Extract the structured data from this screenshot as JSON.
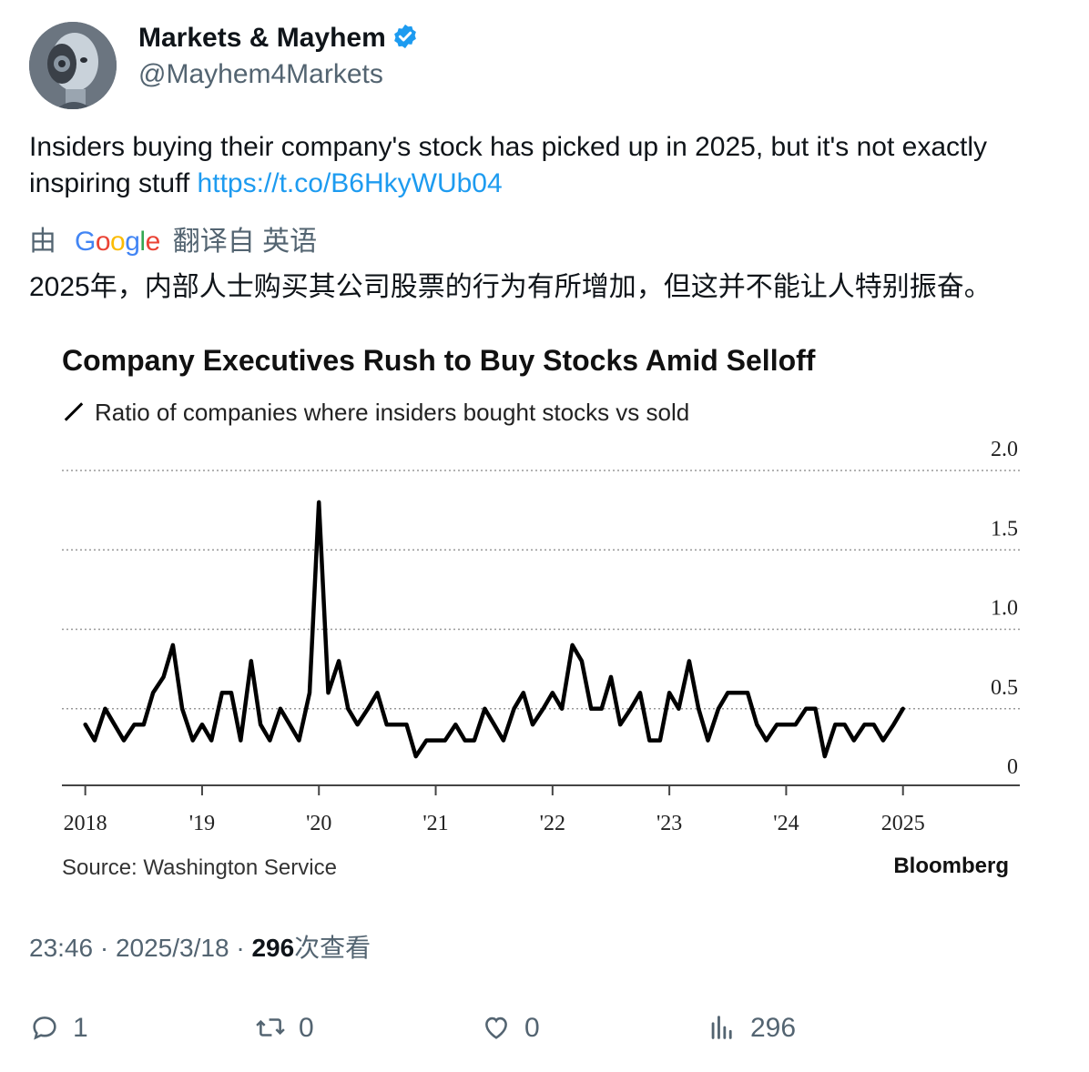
{
  "author": {
    "name": "Markets & Mayhem",
    "handle": "@Mayhem4Markets"
  },
  "tweet": {
    "text": "Insiders buying their company's stock has picked up in 2025, but it's not exactly inspiring stuff ",
    "link": "https://t.co/B6HkyWUb04"
  },
  "translation": {
    "prefix": "由",
    "google_letters": [
      "G",
      "o",
      "o",
      "g",
      "l",
      "e"
    ],
    "google_colors": [
      "#4285F4",
      "#EA4335",
      "#FBBC05",
      "#4285F4",
      "#34A853",
      "#EA4335"
    ],
    "suffix": "翻译自 英语",
    "text": "2025年，内部人士购买其公司股票的行为有所增加，但这并不能让人特别振奋。"
  },
  "chart_data": {
    "type": "line",
    "title": "Company Executives Rush to Buy Stocks Amid Selloff",
    "subtitle": "Ratio of companies where insiders bought stocks vs sold",
    "source": "Source: Washington Service",
    "brand": "Bloomberg",
    "x_tick_labels": [
      "2018",
      "'19",
      "'20",
      "'21",
      "'22",
      "'23",
      "'24",
      "2025"
    ],
    "x_ticks": [
      2018,
      2019,
      2020,
      2021,
      2022,
      2023,
      2024,
      2025
    ],
    "y_tick_labels": [
      "2.0",
      "1.5",
      "1.0",
      "0.5",
      "0"
    ],
    "y_ticks": [
      2.0,
      1.5,
      1.0,
      0.5,
      0
    ],
    "ylim": [
      0,
      2.0
    ],
    "xlim": [
      2017.8,
      2026.0
    ],
    "grid": "horizontal dotted",
    "series": [
      {
        "values": [
          [
            2018.0,
            0.4
          ],
          [
            2018.08,
            0.3
          ],
          [
            2018.17,
            0.5
          ],
          [
            2018.25,
            0.4
          ],
          [
            2018.33,
            0.3
          ],
          [
            2018.42,
            0.4
          ],
          [
            2018.5,
            0.4
          ],
          [
            2018.58,
            0.6
          ],
          [
            2018.67,
            0.7
          ],
          [
            2018.75,
            0.9
          ],
          [
            2018.83,
            0.5
          ],
          [
            2018.92,
            0.3
          ],
          [
            2019.0,
            0.4
          ],
          [
            2019.08,
            0.3
          ],
          [
            2019.17,
            0.6
          ],
          [
            2019.25,
            0.6
          ],
          [
            2019.33,
            0.3
          ],
          [
            2019.42,
            0.8
          ],
          [
            2019.5,
            0.4
          ],
          [
            2019.58,
            0.3
          ],
          [
            2019.67,
            0.5
          ],
          [
            2019.75,
            0.4
          ],
          [
            2019.83,
            0.3
          ],
          [
            2019.92,
            0.6
          ],
          [
            2020.0,
            1.8
          ],
          [
            2020.08,
            0.6
          ],
          [
            2020.17,
            0.8
          ],
          [
            2020.25,
            0.5
          ],
          [
            2020.33,
            0.4
          ],
          [
            2020.42,
            0.5
          ],
          [
            2020.5,
            0.6
          ],
          [
            2020.58,
            0.4
          ],
          [
            2020.67,
            0.4
          ],
          [
            2020.75,
            0.4
          ],
          [
            2020.83,
            0.2
          ],
          [
            2020.92,
            0.3
          ],
          [
            2021.0,
            0.3
          ],
          [
            2021.08,
            0.3
          ],
          [
            2021.17,
            0.4
          ],
          [
            2021.25,
            0.3
          ],
          [
            2021.33,
            0.3
          ],
          [
            2021.42,
            0.5
          ],
          [
            2021.5,
            0.4
          ],
          [
            2021.58,
            0.3
          ],
          [
            2021.67,
            0.5
          ],
          [
            2021.75,
            0.6
          ],
          [
            2021.83,
            0.4
          ],
          [
            2021.92,
            0.5
          ],
          [
            2022.0,
            0.6
          ],
          [
            2022.08,
            0.5
          ],
          [
            2022.17,
            0.9
          ],
          [
            2022.25,
            0.8
          ],
          [
            2022.33,
            0.5
          ],
          [
            2022.42,
            0.5
          ],
          [
            2022.5,
            0.7
          ],
          [
            2022.58,
            0.4
          ],
          [
            2022.67,
            0.5
          ],
          [
            2022.75,
            0.6
          ],
          [
            2022.83,
            0.3
          ],
          [
            2022.92,
            0.3
          ],
          [
            2023.0,
            0.6
          ],
          [
            2023.08,
            0.5
          ],
          [
            2023.17,
            0.8
          ],
          [
            2023.25,
            0.5
          ],
          [
            2023.33,
            0.3
          ],
          [
            2023.42,
            0.5
          ],
          [
            2023.5,
            0.6
          ],
          [
            2023.58,
            0.6
          ],
          [
            2023.67,
            0.6
          ],
          [
            2023.75,
            0.4
          ],
          [
            2023.83,
            0.3
          ],
          [
            2023.92,
            0.4
          ],
          [
            2024.0,
            0.4
          ],
          [
            2024.08,
            0.4
          ],
          [
            2024.17,
            0.5
          ],
          [
            2024.25,
            0.5
          ],
          [
            2024.33,
            0.2
          ],
          [
            2024.42,
            0.4
          ],
          [
            2024.5,
            0.4
          ],
          [
            2024.58,
            0.3
          ],
          [
            2024.67,
            0.4
          ],
          [
            2024.75,
            0.4
          ],
          [
            2024.83,
            0.3
          ],
          [
            2024.92,
            0.4
          ],
          [
            2025.0,
            0.5
          ]
        ]
      }
    ]
  },
  "meta": {
    "time": "23:46",
    "sep1": " · ",
    "date": "2025/3/18",
    "sep2": " · ",
    "views_count": "296",
    "views_label": "次查看"
  },
  "actions": {
    "replies": "1",
    "reposts": "0",
    "likes": "0",
    "views": "296"
  },
  "colors": {
    "link": "#1d9bf0",
    "muted_text": "#536471",
    "verified_badge": "#1d9bf0",
    "chart_line": "#000000"
  }
}
